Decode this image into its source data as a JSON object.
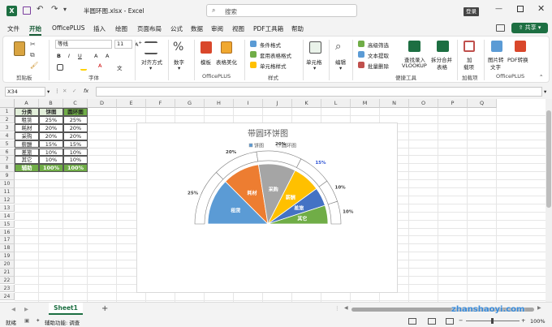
{
  "titlebar": {
    "autosave_icon": "excel-logo-icon",
    "filename": "半圆环图.xlsx",
    "app": "Excel",
    "search_placeholder": "搜索",
    "login": "登录"
  },
  "tabs": [
    "文件",
    "开始",
    "OfficePLUS",
    "插入",
    "绘图",
    "页面布局",
    "公式",
    "数据",
    "审阅",
    "视图",
    "PDF工具箱",
    "帮助"
  ],
  "active_tab": "开始",
  "share_label": "共享",
  "ribbon": {
    "font_name": "等线",
    "font_size": "11",
    "groups": [
      "剪贴板",
      "字体",
      "对齐方式",
      "数字",
      "OfficePLUS",
      "样式",
      "单元格",
      "编辑",
      "便捷工具",
      "加载项",
      "OfficePLUS"
    ],
    "align_label": "对齐方式",
    "number_label": "数字",
    "template_label": "模板",
    "beautify_label": "表格美化",
    "cond_format": "条件格式",
    "table_format": "套用表格格式",
    "cell_style": "单元格样式",
    "cells_label": "单元格",
    "edit_label": "编辑",
    "adv_filter": "高级筛选",
    "text_extract": "文本提取",
    "batch_delete": "批量删除",
    "find_vlookup": [
      "查找录入",
      "VLOOKUP"
    ],
    "split_merge": [
      "拆分合并",
      "表格"
    ],
    "addins": [
      "加",
      "载项"
    ],
    "pic_to_text": [
      "图片转",
      "文字"
    ],
    "pdf_convert": [
      "PDF转换"
    ]
  },
  "formula_bar": {
    "name_box": "X34",
    "fx": "fx",
    "value": ""
  },
  "columns": [
    "A",
    "B",
    "C",
    "D",
    "E",
    "F",
    "G",
    "H",
    "I",
    "J",
    "K",
    "L",
    "M",
    "N",
    "O",
    "P",
    "Q"
  ],
  "rows": [
    "1",
    "2",
    "3",
    "4",
    "5",
    "6",
    "7",
    "8",
    "9",
    "10",
    "11",
    "12",
    "13",
    "14",
    "15",
    "16",
    "17",
    "18",
    "19",
    "20",
    "21",
    "22",
    "23",
    "24"
  ],
  "table": {
    "headers": [
      "分类",
      "饼图",
      "圆环图"
    ],
    "rows": [
      [
        "租赁",
        "25%",
        "25%"
      ],
      [
        "耗材",
        "20%",
        "20%"
      ],
      [
        "采购",
        "20%",
        "20%"
      ],
      [
        "薪酬",
        "15%",
        "15%"
      ],
      [
        "差旅",
        "10%",
        "10%"
      ],
      [
        "其它",
        "10%",
        "10%"
      ],
      [
        "辅助",
        "100%",
        "100%"
      ]
    ]
  },
  "chart_data": {
    "type": "pie",
    "title": "带圆环饼图",
    "legend": [
      "饼图",
      "圆环图"
    ],
    "legend_position": "top",
    "categories": [
      "租赁",
      "耗材",
      "采购",
      "薪酬",
      "差旅",
      "其它"
    ],
    "series": [
      {
        "name": "饼图",
        "values": [
          25,
          20,
          20,
          15,
          10,
          10
        ]
      },
      {
        "name": "圆环图",
        "values": [
          25,
          20,
          20,
          15,
          10,
          10
        ]
      }
    ],
    "data_labels": [
      "25%",
      "20%",
      "20%",
      "15%",
      "10%",
      "10%"
    ],
    "colors": [
      "#5b9bd5",
      "#ed7d31",
      "#a5a5a5",
      "#ffc000",
      "#4472c4",
      "#70ad47"
    ]
  },
  "sheet_tabs": [
    "Sheet1"
  ],
  "status": {
    "ready": "就绪",
    "accessibility": "辅助功能: 调查",
    "zoom": "100%"
  },
  "watermark": "zhanshaoyi.com"
}
